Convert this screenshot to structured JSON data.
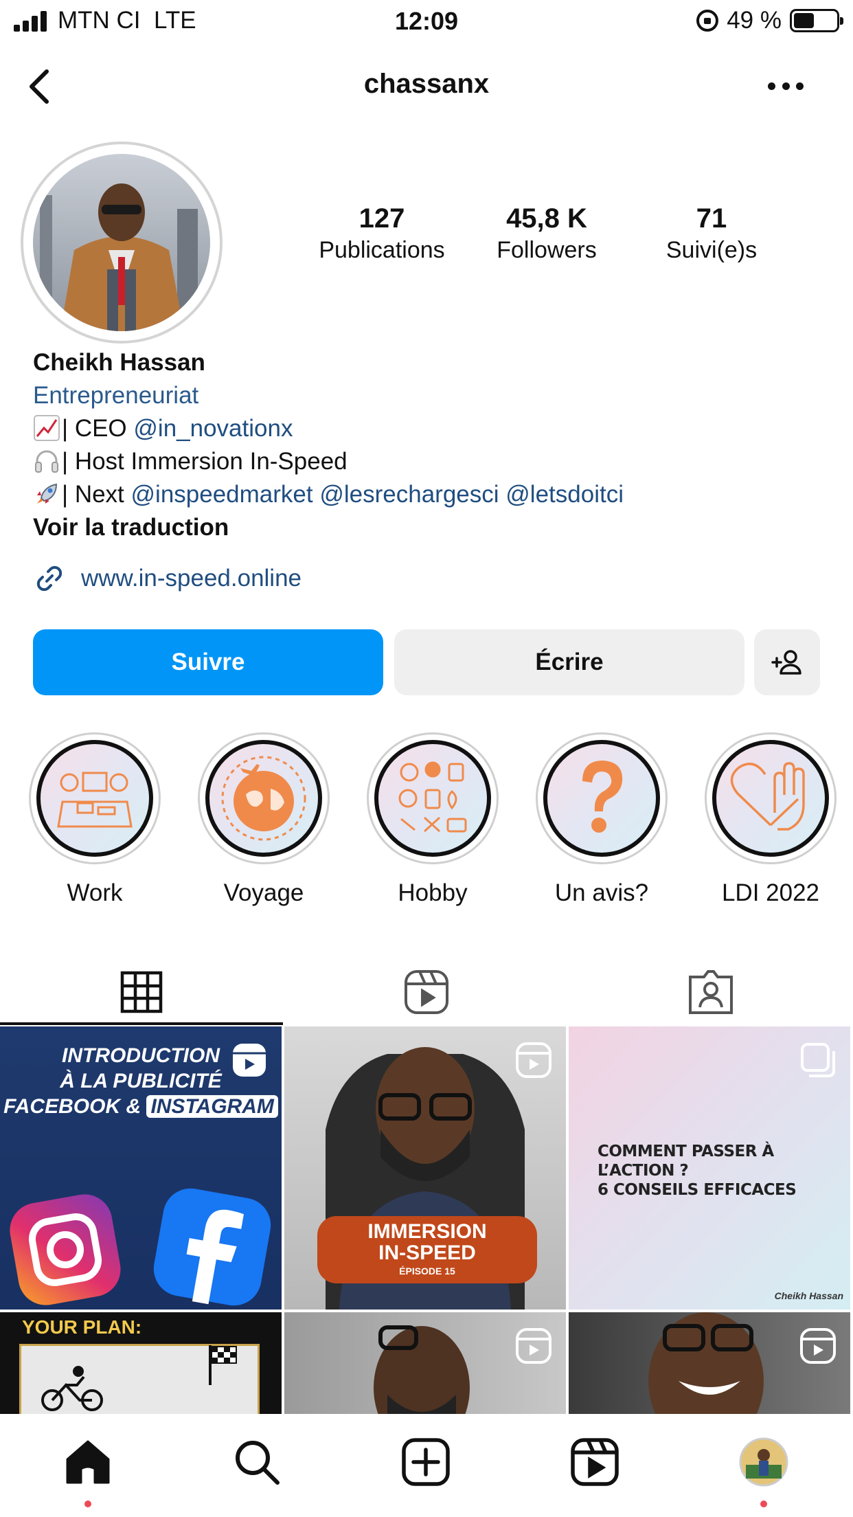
{
  "status_bar": {
    "carrier": "MTN CI",
    "network": "LTE",
    "time": "12:09",
    "battery_text": "49 %",
    "battery_level": 0.49
  },
  "header": {
    "username": "chassanx"
  },
  "stats": [
    {
      "value": "127",
      "label": "Publications"
    },
    {
      "value": "45,8 K",
      "label": "Followers"
    },
    {
      "value": "71",
      "label": "Suivi(e)s"
    }
  ],
  "bio": {
    "name": "Cheikh Hassan",
    "category": "Entrepreneuriat",
    "line1_prefix": "| CEO ",
    "line1_mention": "@in_novationx",
    "line2": "| Host Immersion In-Speed",
    "line3_prefix": "| Next ",
    "line3_mentions": [
      "@inspeedmarket",
      "@lesrechargesci",
      "@letsdoitci"
    ],
    "translate": "Voir la traduction",
    "link": "www.in-speed.online"
  },
  "actions": {
    "follow": "Suivre",
    "message": "Écrire"
  },
  "highlights": [
    {
      "label": "Work",
      "icon": "team-meeting-icon"
    },
    {
      "label": "Voyage",
      "icon": "globe-plane-icon"
    },
    {
      "label": "Hobby",
      "icon": "hobbies-icon"
    },
    {
      "label": "Un avis?",
      "icon": "question-mark-icon"
    },
    {
      "label": "LDI 2022",
      "icon": "heart-hand-icon"
    }
  ],
  "tabs": [
    "grid-tab",
    "reels-tab",
    "tagged-tab"
  ],
  "posts": [
    {
      "title_lines": [
        "INTRODUCTION",
        "À LA PUBLICITÉ",
        "FACEBOOK &",
        "INSTAGRAM"
      ],
      "type": "reel"
    },
    {
      "title_lines": [
        "IMMERSION",
        "IN-SPEED",
        "ÉPISODE 15"
      ],
      "type": "reel"
    },
    {
      "title_lines": [
        "COMMENT PASSER À L’ACTION ?",
        "6 CONSEILS EFFICACES"
      ],
      "signature": "Cheikh Hassan",
      "type": "carousel"
    },
    {
      "title_lines": [
        "YOUR PLAN:"
      ],
      "type": "image"
    },
    {
      "title_lines": [],
      "type": "reel"
    },
    {
      "title_lines": [],
      "type": "reel"
    }
  ],
  "colors": {
    "primary_button": "#0095f6",
    "secondary_button": "#efefef",
    "link": "#1f4d80",
    "notification_dot": "#ed4956",
    "highlight_icon": "#f08a4b"
  }
}
